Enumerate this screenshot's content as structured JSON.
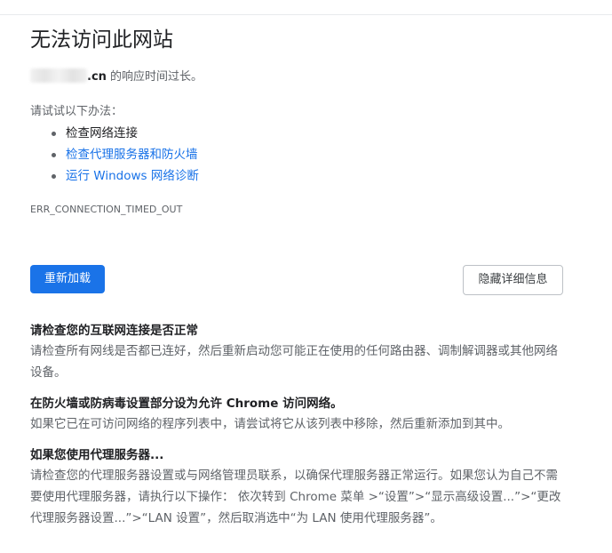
{
  "error_page": {
    "title": "无法访问此网站",
    "domain_suffix": ".cn",
    "subtitle_rest": " 的响应时间过长。",
    "suggest_label": "请试试以下办法：",
    "suggestions": [
      {
        "text": "检查网络连接"
      },
      {
        "text": "检查代理服务器和防火墙"
      },
      {
        "text": "运行 Windows 网络诊断"
      }
    ],
    "error_code": "ERR_CONNECTION_TIMED_OUT",
    "reload_label": "重新加载",
    "hide_details_label": "隐藏详细信息"
  },
  "details": [
    {
      "heading": "请检查您的互联网连接是否正常",
      "body": "请检查所有网线是否都已连好，然后重新启动您可能正在使用的任何路由器、调制解调器或其他网络设备。"
    },
    {
      "heading": "在防火墙或防病毒设置部分设为允许 Chrome 访问网络。",
      "body": "如果它已在可访问网络的程序列表中，请尝试将它从该列表中移除，然后重新添加到其中。"
    },
    {
      "heading": "如果您使用代理服务器...",
      "body": "请检查您的代理服务器设置或与网络管理员联系，以确保代理服务器正常运行。如果您认为自己不需要使用代理服务器，请执行以下操作： 依次转到 Chrome 菜单 >“设置”>“显示高级设置...”>“更改代理服务器设置...”>“LAN 设置”，然后取消选中“为 LAN 使用代理服务器”。"
    }
  ],
  "colors": {
    "accent": "#1a73e8",
    "text_primary": "#202124",
    "text_secondary": "#5f6368"
  }
}
